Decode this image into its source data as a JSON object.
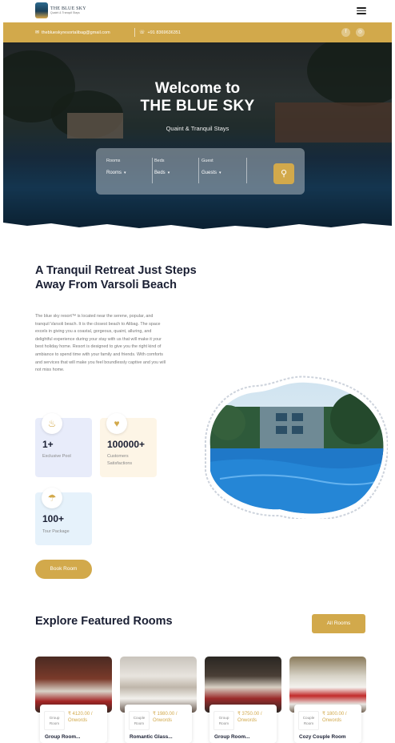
{
  "brand": {
    "name": "THE BLUE SKY",
    "tagline": "Quaint & Tranquil Stays"
  },
  "contact": {
    "email": "theblueskyresortalibag@gmail.com",
    "phone": "+91 8369636351"
  },
  "hero": {
    "line1": "Welcome to",
    "line2": "THE BLUE SKY",
    "subtitle": "Quaint & Tranquil Stays"
  },
  "search": {
    "fields": [
      {
        "label": "Rooms",
        "value": "Rooms"
      },
      {
        "label": "Beds",
        "value": "Beds"
      },
      {
        "label": "Guest",
        "value": "Guests"
      }
    ]
  },
  "about": {
    "title": "A Tranquil Retreat Just Steps Away From Varsoli Beach",
    "body": "The blue sky resort™ is located near the serene, popular, and tranquil Varsoli beach. It is the closest beach to Alibag. The space excels in giving you a coastal, gorgeous, quaint, alluring, and delightful experience during your stay with us that will make it your best holiday home. Resort is designed to give you the right kind of ambiance to spend time with your family and friends. With comforts and services that will make you feel boundlessly captive and you will not miss home."
  },
  "stats": [
    {
      "number": "1+",
      "caption": "Exclusive Pool",
      "icon": "pool-icon",
      "bg": "#e8ecfa"
    },
    {
      "number": "100000+",
      "caption": "Customers Satisfactions",
      "icon": "heart-icon",
      "bg": "#fdf5e6"
    },
    {
      "number": "100+",
      "caption": "Tour Package",
      "icon": "beach-umbrella-icon",
      "bg": "#e6f2fb"
    }
  ],
  "book_button": "Book Room",
  "rooms_section": {
    "title": "Explore Featured Rooms",
    "all_button": "All Rooms"
  },
  "rooms": [
    {
      "type": "Group Room",
      "price": "₹ 4120.00 / Onwords",
      "name": "Group Room..."
    },
    {
      "type": "Couple Room",
      "price": "₹ 1980.00 / Onwords",
      "name": "Romantic Glass..."
    },
    {
      "type": "Group Room",
      "price": "₹ 3750.00 / Onwords",
      "name": "Group Room..."
    },
    {
      "type": "Couple Room",
      "price": "₹ 1800.00 / Onwords",
      "name": "Cozy Couple Room"
    }
  ],
  "colors": {
    "accent": "#d2a94b",
    "heading": "#1a1f33"
  }
}
